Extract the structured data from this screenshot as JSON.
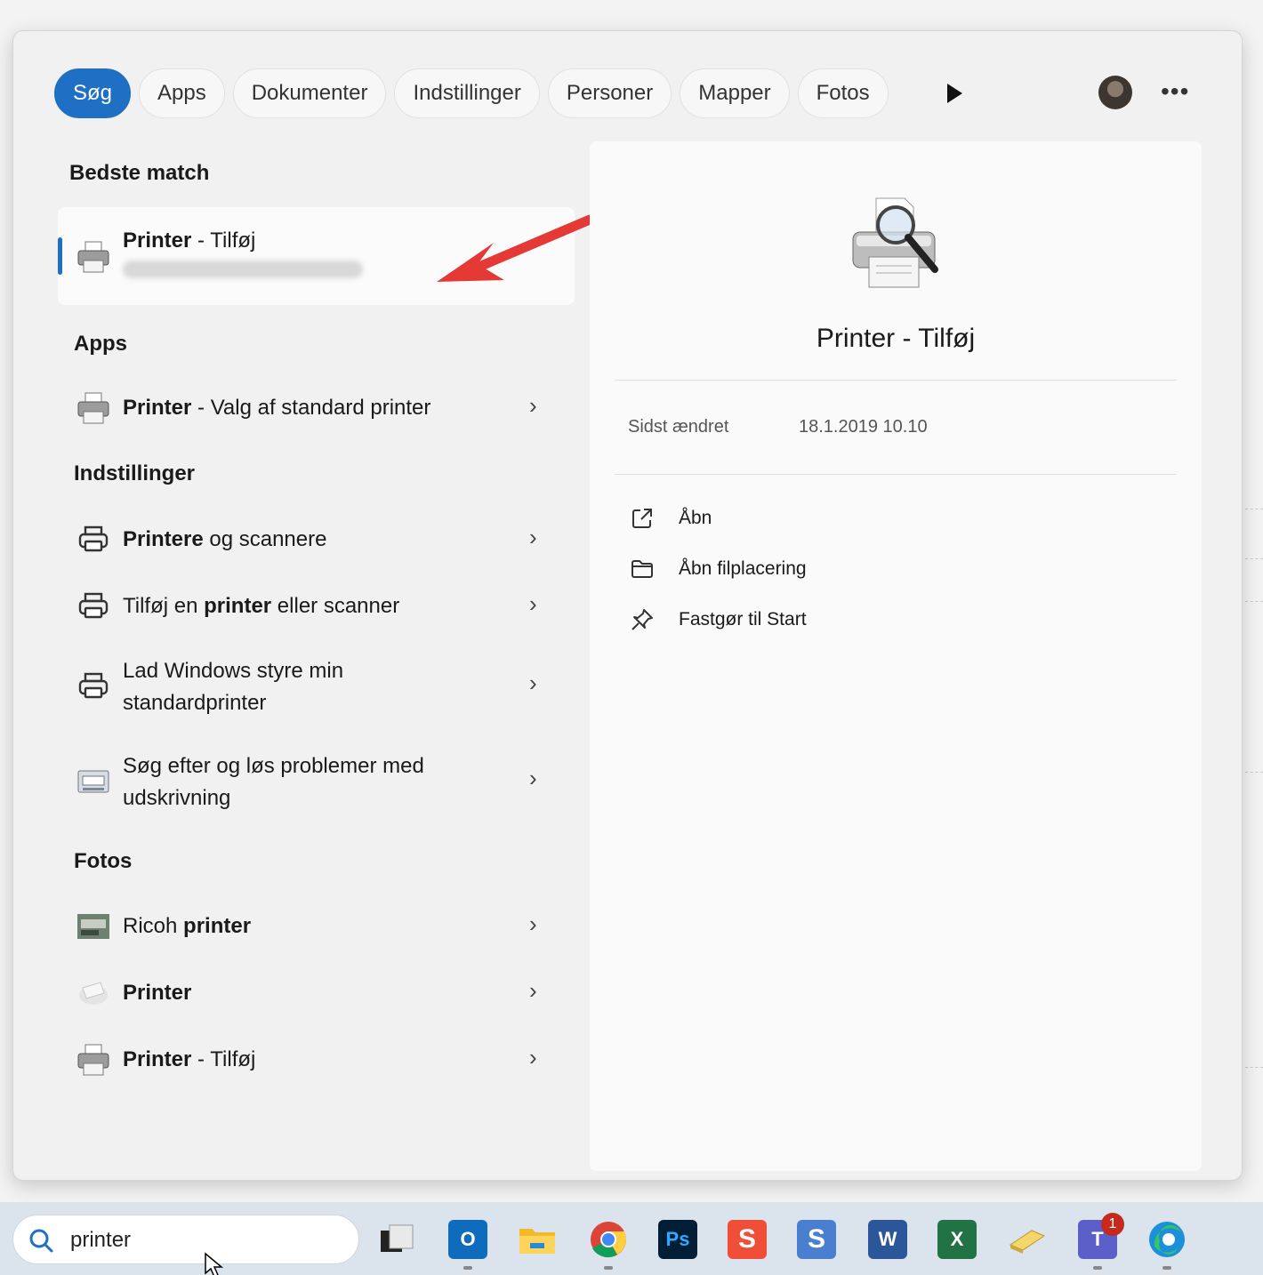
{
  "filters": {
    "tabs": [
      "Søg",
      "Apps",
      "Dokumenter",
      "Indstillinger",
      "Personer",
      "Mapper",
      "Fotos"
    ]
  },
  "best_match": {
    "heading": "Bedste match",
    "title_bold": "Printer",
    "title_rest": " - Tilføj"
  },
  "apps": {
    "heading": "Apps",
    "item_bold": "Printer",
    "item_rest": " - Valg af standard printer"
  },
  "settings": {
    "heading": "Indstillinger",
    "item1_bold": "Printere",
    "item1_rest": " og scannere",
    "item2_pre": "Tilføj en ",
    "item2_bold": "printer",
    "item2_post": " eller scanner",
    "item3_line1": "Lad Windows styre min",
    "item3_line2": "standardprinter",
    "item4_line1": "Søg efter og løs problemer med",
    "item4_line2": "udskrivning"
  },
  "photos": {
    "heading": "Fotos",
    "item1_pre": "Ricoh ",
    "item1_bold": "printer",
    "item2_bold": "Printer",
    "item3_bold": "Printer",
    "item3_rest": " - Tilføj"
  },
  "preview": {
    "title": "Printer - Tilføj",
    "modified_label": "Sidst ændret",
    "modified_value": "18.1.2019 10.10",
    "actions": [
      "Åbn",
      "Åbn filplacering",
      "Fastgør til Start"
    ]
  },
  "taskbar": {
    "search_value": "printer",
    "teams_badge": "1",
    "apps": [
      "task-view",
      "outlook",
      "file-explorer",
      "chrome",
      "photoshop",
      "app-s-red",
      "app-s-blue",
      "word",
      "excel",
      "notes",
      "teams",
      "edge"
    ]
  },
  "colors": {
    "accent": "#1f6fc4",
    "annotation": "#e53935"
  }
}
